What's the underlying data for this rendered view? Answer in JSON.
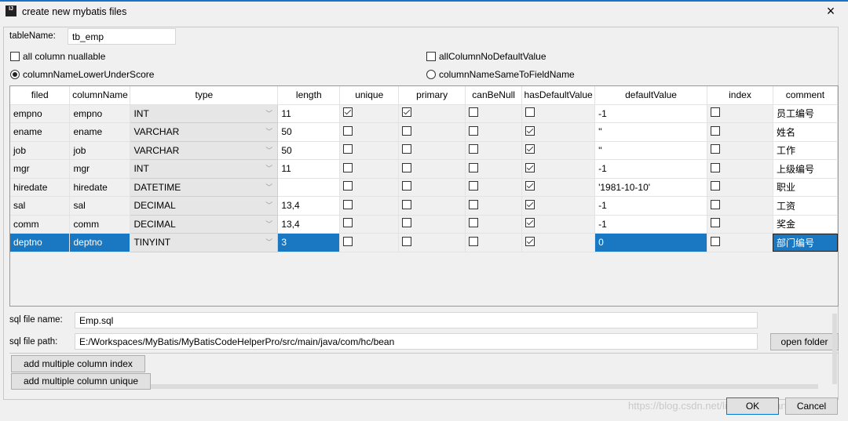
{
  "window": {
    "title": "create new mybatis files",
    "icon": "intellij-icon",
    "close": "×"
  },
  "form": {
    "tableName_label": "tableName:",
    "tableName_value": "tb_emp",
    "allColumnNullable": {
      "label": "all column nuallable",
      "checked": false
    },
    "allColumnNoDefaultValue": {
      "label": "allColumnNoDefaultValue",
      "checked": false
    },
    "columnNameLowerUnderScore": {
      "label": "columnNameLowerUnderScore",
      "selected": true
    },
    "columnNameSameToFieldName": {
      "label": "columnNameSameToFieldName",
      "selected": false
    }
  },
  "table": {
    "headers": [
      "filed",
      "columnName",
      "type",
      "length",
      "unique",
      "primary",
      "canBeNull",
      "hasDefaultValue",
      "defaultValue",
      "index",
      "comment"
    ],
    "rows": [
      {
        "filed": "empno",
        "columnName": "empno",
        "type": "INT",
        "length": "11",
        "unique": true,
        "primary": true,
        "canBeNull": false,
        "hasDefaultValue": false,
        "defaultValue": "-1",
        "index": false,
        "comment": "员工编号"
      },
      {
        "filed": "ename",
        "columnName": "ename",
        "type": "VARCHAR",
        "length": "50",
        "unique": false,
        "primary": false,
        "canBeNull": false,
        "hasDefaultValue": true,
        "defaultValue": "''",
        "index": false,
        "comment": "姓名"
      },
      {
        "filed": "job",
        "columnName": "job",
        "type": "VARCHAR",
        "length": "50",
        "unique": false,
        "primary": false,
        "canBeNull": false,
        "hasDefaultValue": true,
        "defaultValue": "''",
        "index": false,
        "comment": "工作"
      },
      {
        "filed": "mgr",
        "columnName": "mgr",
        "type": "INT",
        "length": "11",
        "unique": false,
        "primary": false,
        "canBeNull": false,
        "hasDefaultValue": true,
        "defaultValue": "-1",
        "index": false,
        "comment": "上级编号"
      },
      {
        "filed": "hiredate",
        "columnName": "hiredate",
        "type": "DATETIME",
        "length": "",
        "unique": false,
        "primary": false,
        "canBeNull": false,
        "hasDefaultValue": true,
        "defaultValue": "'1981-10-10'",
        "index": false,
        "comment": "职业"
      },
      {
        "filed": "sal",
        "columnName": "sal",
        "type": "DECIMAL",
        "length": "13,4",
        "unique": false,
        "primary": false,
        "canBeNull": false,
        "hasDefaultValue": true,
        "defaultValue": "-1",
        "index": false,
        "comment": "工资"
      },
      {
        "filed": "comm",
        "columnName": "comm",
        "type": "DECIMAL",
        "length": "13,4",
        "unique": false,
        "primary": false,
        "canBeNull": false,
        "hasDefaultValue": true,
        "defaultValue": "-1",
        "index": false,
        "comment": "奖金"
      },
      {
        "filed": "deptno",
        "columnName": "deptno",
        "type": "TINYINT",
        "length": "3",
        "unique": false,
        "primary": false,
        "canBeNull": false,
        "hasDefaultValue": true,
        "defaultValue": "0",
        "index": false,
        "comment": "部门编号",
        "selected": true
      }
    ]
  },
  "sql": {
    "name_label": "sql file name:",
    "name_value": "Emp.sql",
    "path_label": "sql file path:",
    "path_value": "E:/Workspaces/MyBatis/MyBatisCodeHelperPro/src/main/java/com/hc/bean",
    "open_folder": "open folder"
  },
  "buttons": {
    "add_index": "add multiple column index",
    "add_unique": "add multiple column unique",
    "ok": "OK",
    "cancel": "Cancel"
  },
  "watermark": "https://blog.csdn.net/liangneeda/article"
}
